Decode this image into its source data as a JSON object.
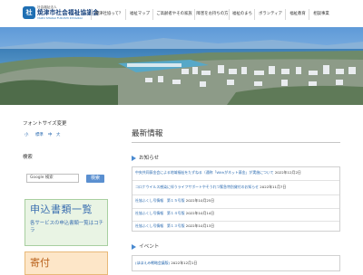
{
  "header": {
    "org_type": "社会福祉法人",
    "org_name": "焼津市社会福祉協議会",
    "org_roman": "YAIZU SHAKAI FUKUSHI KYOGIKAI",
    "nav": [
      {
        "label": "焼津社協って？"
      },
      {
        "label": "福祉マップ"
      },
      {
        "label": "ご高齢者やその家族"
      },
      {
        "label": "障害をお持ちの方"
      },
      {
        "label": "福祉のまち"
      },
      {
        "label": "ボランティア"
      },
      {
        "label": "福祉教育"
      },
      {
        "label": "相談事業"
      }
    ]
  },
  "sidebar": {
    "font_size_label": "フォントサイズ変更",
    "font_sizes": [
      "小",
      "標準",
      "中",
      "大"
    ],
    "search_label": "検索",
    "search_placeholder": "Google 検索",
    "search_button": "検索",
    "banner_application": {
      "title": "申込書類一覧",
      "subtitle": "各サービスの申込書類一覧はコチラ"
    },
    "banner_donation": {
      "title": "寄付"
    }
  },
  "main": {
    "title": "最新情報",
    "notice_label": "お知らせ",
    "notices": [
      {
        "text": "中央共同募金会による地域福祉をたずねる（通称「Withがネット募金」が実施について",
        "date": "2022年12月2日"
      },
      {
        "text": "コロナウイルス感染に伴うライフサポートやそうれつ緊急特別貸付のお知らせ",
        "date": "2022年11月7日"
      },
      {
        "text": "社協ふくし号情報　第１５号版",
        "date": "2022年10月25日"
      },
      {
        "text": "社協ふくし号情報　第１４号版",
        "date": "2022年10月14日"
      },
      {
        "text": "社協ふくし号情報　第１３号版",
        "date": "2022年10月13日"
      }
    ],
    "event_label": "イベント",
    "events": [
      {
        "text": "(ほほえみ戦略会議版)",
        "date": "2022年12月1日"
      }
    ]
  },
  "colors": {
    "brand": "#1f6fb3",
    "link": "#2a6ab0",
    "banner_green_bg": "#e9f4e4",
    "banner_orange_bg": "#fde6c8"
  }
}
